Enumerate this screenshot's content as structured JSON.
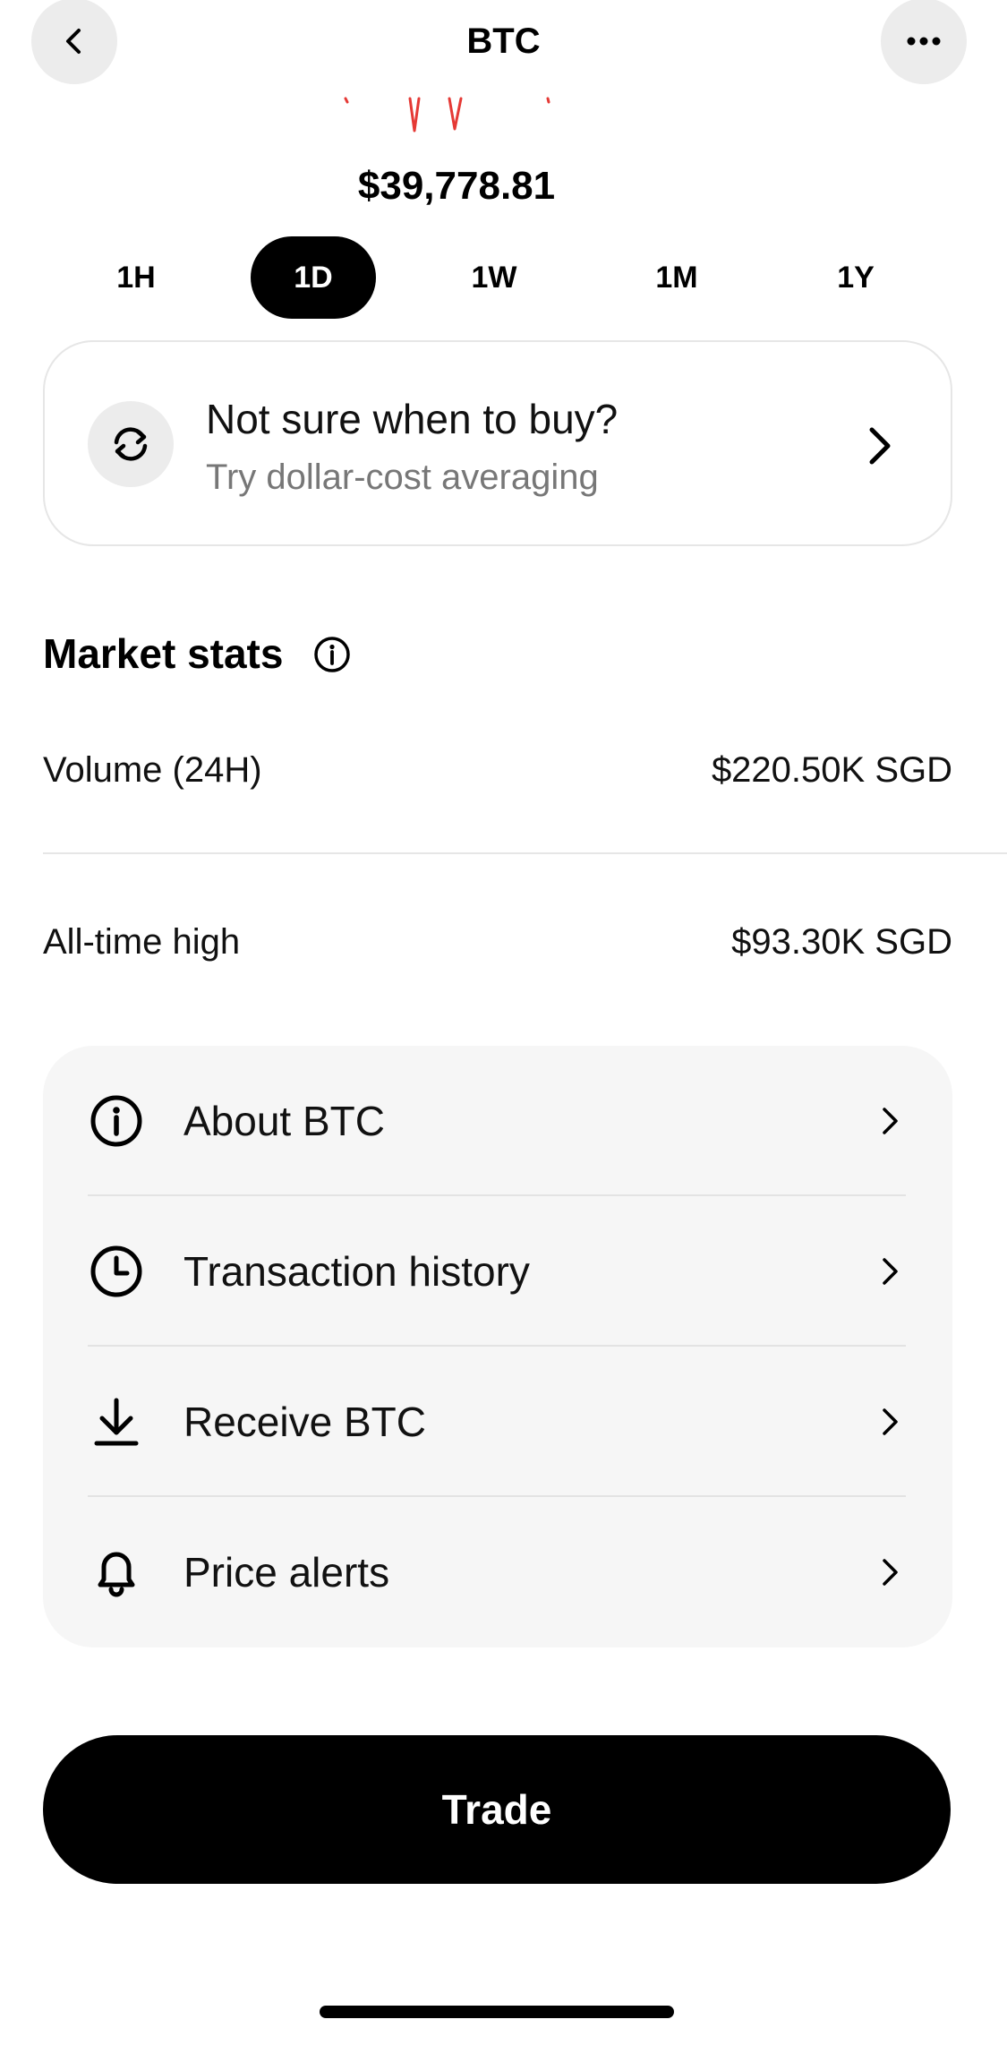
{
  "header": {
    "title": "BTC",
    "back_icon": "chevron-left-icon",
    "more_icon": "more-horizontal-icon"
  },
  "price": "$39,778.81",
  "chart_color": "#e53935",
  "ranges": [
    {
      "label": "1H",
      "active": false
    },
    {
      "label": "1D",
      "active": true
    },
    {
      "label": "1W",
      "active": false
    },
    {
      "label": "1M",
      "active": false
    },
    {
      "label": "1Y",
      "active": false
    }
  ],
  "dca": {
    "title": "Not sure when to buy?",
    "subtitle": "Try dollar-cost averaging",
    "icon": "refresh-arrows-icon"
  },
  "market_stats": {
    "title": "Market stats",
    "rows": [
      {
        "label": "Volume (24H)",
        "value": "$220.50K SGD"
      },
      {
        "label": "All-time high",
        "value": "$93.30K SGD"
      }
    ]
  },
  "menu": [
    {
      "label": "About BTC",
      "icon": "info-icon"
    },
    {
      "label": "Transaction history",
      "icon": "clock-icon"
    },
    {
      "label": "Receive BTC",
      "icon": "download-icon"
    },
    {
      "label": "Price alerts",
      "icon": "bell-icon"
    }
  ],
  "trade_label": "Trade"
}
